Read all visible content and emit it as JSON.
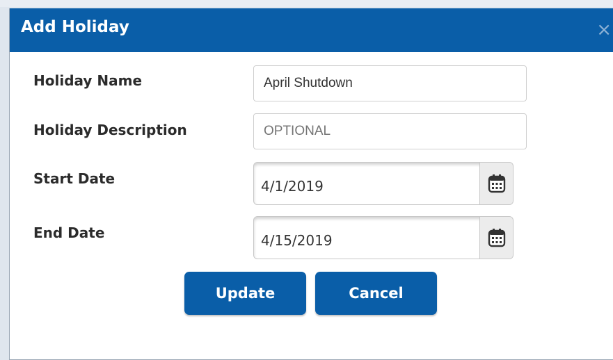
{
  "dialog": {
    "title": "Add Holiday",
    "close_glyph": "×"
  },
  "form": {
    "holiday_name": {
      "label": "Holiday Name",
      "value": "April Shutdown",
      "placeholder": ""
    },
    "holiday_description": {
      "label": "Holiday Description",
      "value": "",
      "placeholder": "OPTIONAL"
    },
    "start_date": {
      "label": "Start Date",
      "value": "4/1/2019"
    },
    "end_date": {
      "label": "End Date",
      "value": "4/15/2019"
    }
  },
  "buttons": {
    "update_label": "Update",
    "cancel_label": "Cancel"
  },
  "icons": {
    "close": "close-icon",
    "calendar": "calendar-icon"
  },
  "colors": {
    "accent": "#0a5ea8",
    "title_text": "#ffffff"
  }
}
